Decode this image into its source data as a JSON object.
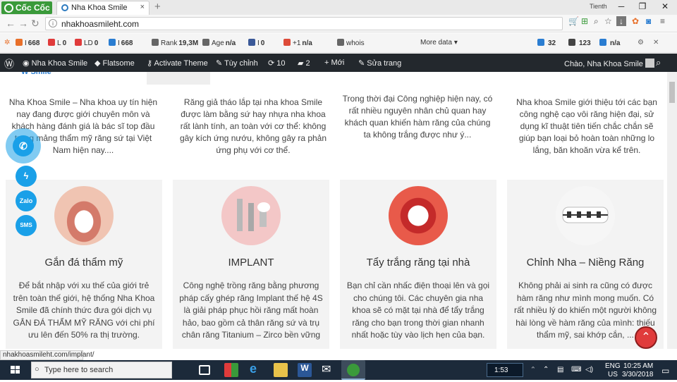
{
  "browser": {
    "brand": "Cốc Cốc",
    "tab_title": "Nha Khoa Smile",
    "tab_close": "×",
    "new_tab": "+",
    "user": "Tienth",
    "url": "nhakhoasmileht.com"
  },
  "seo_toolbar": {
    "items": [
      {
        "label": "I",
        "value": "668",
        "color": "#e8702a"
      },
      {
        "label": "L",
        "value": "0",
        "color": "#e03b3b"
      },
      {
        "label": "LD",
        "value": "0",
        "color": "#e03b3b"
      },
      {
        "label": "I",
        "value": "668",
        "color": "#2a7dd1"
      },
      {
        "label": "Rank",
        "value": "19,3M",
        "color": "#666666"
      },
      {
        "label": "Age",
        "value": "n/a",
        "color": "#666666"
      },
      {
        "label": "I",
        "value": "0",
        "color": "#3b5998"
      },
      {
        "label": "+1",
        "value": "n/a",
        "color": "#dd4b39"
      },
      {
        "label": "whois",
        "value": "",
        "color": "#666666"
      },
      {
        "label": "More data",
        "value": "▾",
        "color": "#f5f5f5"
      },
      {
        "label": "32",
        "value": "",
        "color": "#2a7dd1"
      },
      {
        "label": "123",
        "value": "",
        "color": "#444444"
      },
      {
        "label": "n/a",
        "value": "",
        "color": "#2a7dd1"
      }
    ]
  },
  "wp_admin": {
    "site": "Nha Khoa Smile",
    "theme": "Flatsome",
    "activate": "Activate Theme",
    "customize": "Tùy chỉnh",
    "updates": "10",
    "comments": "2",
    "new": "Mới",
    "edit": "Sửa trang",
    "greeting": "Chào, Nha Khoa Smile"
  },
  "top_texts": [
    "Nha Khoa Smile – Nha khoa uy tín hiện nay đang được giới chuyên môn và khách hàng đánh giá là bác sĩ top đầu trong mảng thẩm mỹ răng sứ tại Việt Nam hiện nay....",
    "Răng giả tháo lắp tại nha khoa Smile được làm bằng sứ hay nhựa nha khoa rất lành tính, an toàn với cơ thể: không gây kích ứng nướu, không gây ra phản ứng phụ với cơ thể.",
    "Trong thời đại Công nghiệp hiện nay, có rất nhiều nguyên nhân chủ quan hay khách quan khiến hàm răng của chúng ta không trắng được như ý...",
    "Nha khoa Smile giới thiệu tới các bạn công nghệ cạo vôi răng hiện đại, sử dụng kĩ thuật tiên tiến chắc chắn sẽ giúp bạn loại bỏ hoàn toàn những lo lắng, băn khoăn vừa kể trên."
  ],
  "cards": [
    {
      "title": "Gắn đá thẩm mỹ",
      "desc": "Để bắt nhập với xu thế của giới trẻ trên toàn thế giới, hệ thống Nha Khoa Smile đã chính thức đưa gói dịch vụ GẮN ĐÁ THẨM MỸ RĂNG với chi phí ưu lên đến 50% ra thị trường."
    },
    {
      "title": "IMPLANT",
      "desc": "Công nghệ trồng răng bằng phương pháp cấy ghép răng Implant thế hệ 4S là giải pháp phục hồi răng mất hoàn hảo, bao gồm cả thân răng sứ và trụ chân răng Titanium – Zirco bền vững"
    },
    {
      "title": "Tẩy trắng răng tại nhà",
      "desc": "Bạn chỉ cần nhấc điện thoại lên và gọi cho chúng tôi. Các chuyên gia nha khoa sẽ có mặt tại nhà để tẩy trắng răng cho bạn trong thời gian nhanh nhất hoặc tùy vào lịch hẹn của bạn."
    },
    {
      "title": "Chỉnh Nha – Niềng Răng",
      "desc": "Không phải ai sinh ra cũng có được hàm răng như mình mong muốn. Có rất nhiều lý do khiến một người không hài lòng về hàm răng của mình: thiếu thẩm mỹ, sai khớp cắn, ..."
    }
  ],
  "contact": {
    "zalo": "Zalo",
    "sms": "SMS"
  },
  "status_url": "nhakhoasmileht.com/implant/",
  "taskbar": {
    "search_placeholder": "Type here to search",
    "time": "10:25 AM",
    "date": "3/30/2018",
    "lang": "ENG",
    "region": "US",
    "media_time": "1:53"
  }
}
